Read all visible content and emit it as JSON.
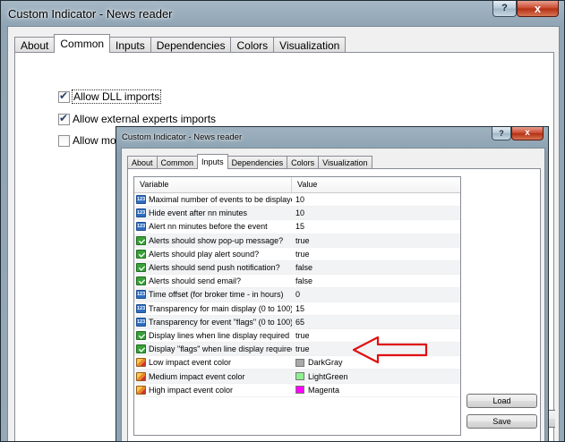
{
  "outer": {
    "title": "Custom Indicator - News reader",
    "tabs": [
      "About",
      "Common",
      "Inputs",
      "Dependencies",
      "Colors",
      "Visualization"
    ],
    "checkboxes": [
      {
        "label": "Allow DLL imports",
        "checked": true
      },
      {
        "label": "Allow external experts imports",
        "checked": true
      },
      {
        "label": "Allow modi",
        "checked": false
      }
    ],
    "close_glyph": "x",
    "help_glyph": "?"
  },
  "inner": {
    "title": "Custom Indicator - News reader",
    "tabs": [
      "About",
      "Common",
      "Inputs",
      "Dependencies",
      "Colors",
      "Visualization"
    ],
    "columns": [
      "Variable",
      "Value"
    ],
    "rows": [
      {
        "icon": "number-icon",
        "variable": "Maximal number of events to be displayed",
        "value": "10"
      },
      {
        "icon": "number-icon",
        "variable": "Hide event after nn minutes",
        "value": "10"
      },
      {
        "icon": "number-icon",
        "variable": "Alert nn minutes before the event",
        "value": "15"
      },
      {
        "icon": "boolean-icon",
        "variable": "Alerts should show pop-up message?",
        "value": "true"
      },
      {
        "icon": "boolean-icon",
        "variable": "Alerts should play alert sound?",
        "value": "true"
      },
      {
        "icon": "boolean-icon",
        "variable": "Alerts should send push notification?",
        "value": "false"
      },
      {
        "icon": "boolean-icon",
        "variable": "Alerts should send email?",
        "value": "false"
      },
      {
        "icon": "number-icon",
        "variable": "Time offset (for broker time - in hours)",
        "value": "0"
      },
      {
        "icon": "number-icon",
        "variable": "Transparency for main display (0 to 100)",
        "value": "15"
      },
      {
        "icon": "number-icon",
        "variable": "Transparency for event \"flags\" (0 to 100)",
        "value": "65"
      },
      {
        "icon": "boolean-icon",
        "variable": "Display lines when line display required",
        "value": "true"
      },
      {
        "icon": "boolean-icon",
        "variable": "Display \"flags\" when line display required",
        "value": "true"
      },
      {
        "icon": "color-icon",
        "variable": "Low impact event color",
        "value": "DarkGray",
        "swatch": "#a9a9a9"
      },
      {
        "icon": "color-icon",
        "variable": "Medium impact event color",
        "value": "LightGreen",
        "swatch": "#90ee90"
      },
      {
        "icon": "color-icon",
        "variable": "High impact event color",
        "value": "Magenta",
        "swatch": "#ff00ff"
      }
    ],
    "buttons": {
      "load": "Load",
      "save": "Save"
    },
    "icon_labels": {
      "number": "123"
    },
    "close_glyph": "x",
    "help_glyph": "?"
  },
  "annotation": {
    "arrow_color": "#e01010"
  }
}
